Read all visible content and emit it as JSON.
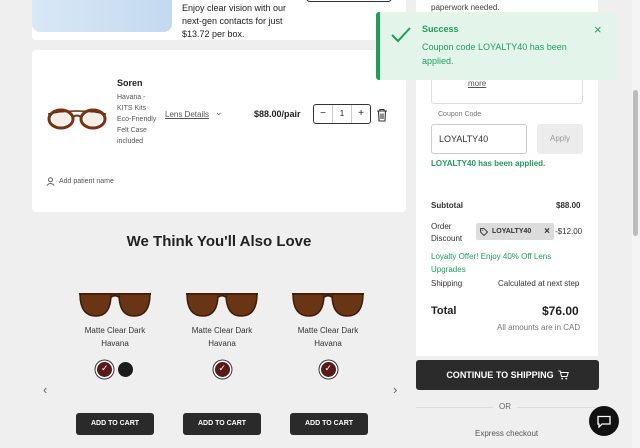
{
  "top_card": {
    "description": "Enjoy clear vision with our next-gen contacts for just $13.72 per box."
  },
  "cart_item": {
    "name": "Soren",
    "details": "Havana - KITS Kits Eco-Friendly Felt Case included",
    "lens_details_link": "Lens Details",
    "price": "$88.00/pair",
    "quantity": "1",
    "decrement": "−",
    "increment": "+",
    "add_patient": "Add patient name"
  },
  "recommendations": {
    "heading": "We Think You'll Also Love",
    "items": [
      {
        "name": "Matte Clear Dark Havana",
        "add_to_cart": "ADD TO CART"
      },
      {
        "name": "Matte Clear Dark Havana",
        "add_to_cart": "ADD TO CART"
      },
      {
        "name": "Matte Clear Dark Havana",
        "add_to_cart": "ADD TO CART"
      }
    ],
    "prev_arrow": "‹",
    "next_arrow": "›"
  },
  "summary": {
    "paperwork_note": "paperwork needed.",
    "more_link": "more",
    "coupon_label": "Coupon Code",
    "coupon_value": "LOYALTY40",
    "apply_label": "Apply",
    "applied_message": "LOYALTY40 has been applied.",
    "subtotal_label": "Subtotal",
    "subtotal_value": "$88.00",
    "discount_label": "Order Discount",
    "discount_code": "LOYALTY40",
    "discount_value": "-$12.00",
    "loyalty_offer": "Loyalty Offer! Enjoy 40% Off Lens Upgrades",
    "shipping_label": "Shipping",
    "shipping_value": "Calculated at next step",
    "total_label": "Total",
    "total_value": "$76.00",
    "currency_note": "All amounts are in CAD",
    "continue_button": "CONTINUE TO SHIPPING",
    "or_text": "OR",
    "express_checkout": "Express checkout"
  },
  "toast": {
    "title": "Success",
    "message": "Coupon code LOYALTY40 has been applied.",
    "close": "×"
  },
  "colors": {
    "success_green": "#1e9e5a",
    "toast_bg": "#e3f5ea",
    "dark_button": "#2b2b2b"
  }
}
